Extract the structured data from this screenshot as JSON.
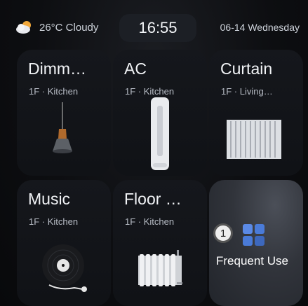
{
  "status_bar": {
    "weather_icon": "cloud-sun-icon",
    "weather_text": "26°C Cloudy",
    "time": "16:55",
    "date": "06-14 Wednesday"
  },
  "devices": [
    {
      "title": "Dimm…",
      "location": "1F · Kitchen",
      "icon": "pendant-lamp-icon"
    },
    {
      "title": "AC",
      "location": "1F · Kitchen",
      "icon": "air-conditioner-icon"
    },
    {
      "title": "Curtain",
      "location": "1F · Living…",
      "icon": "curtain-icon"
    },
    {
      "title": "Music",
      "location": "1F · Kitchen",
      "icon": "turntable-icon"
    },
    {
      "title": "Floor …",
      "location": "1F · Kitchen",
      "icon": "radiator-icon"
    }
  ],
  "frequent": {
    "badge": "1",
    "label": "Frequent Use",
    "icon": "app-grid-icon",
    "accent": "#4a7bd8"
  }
}
